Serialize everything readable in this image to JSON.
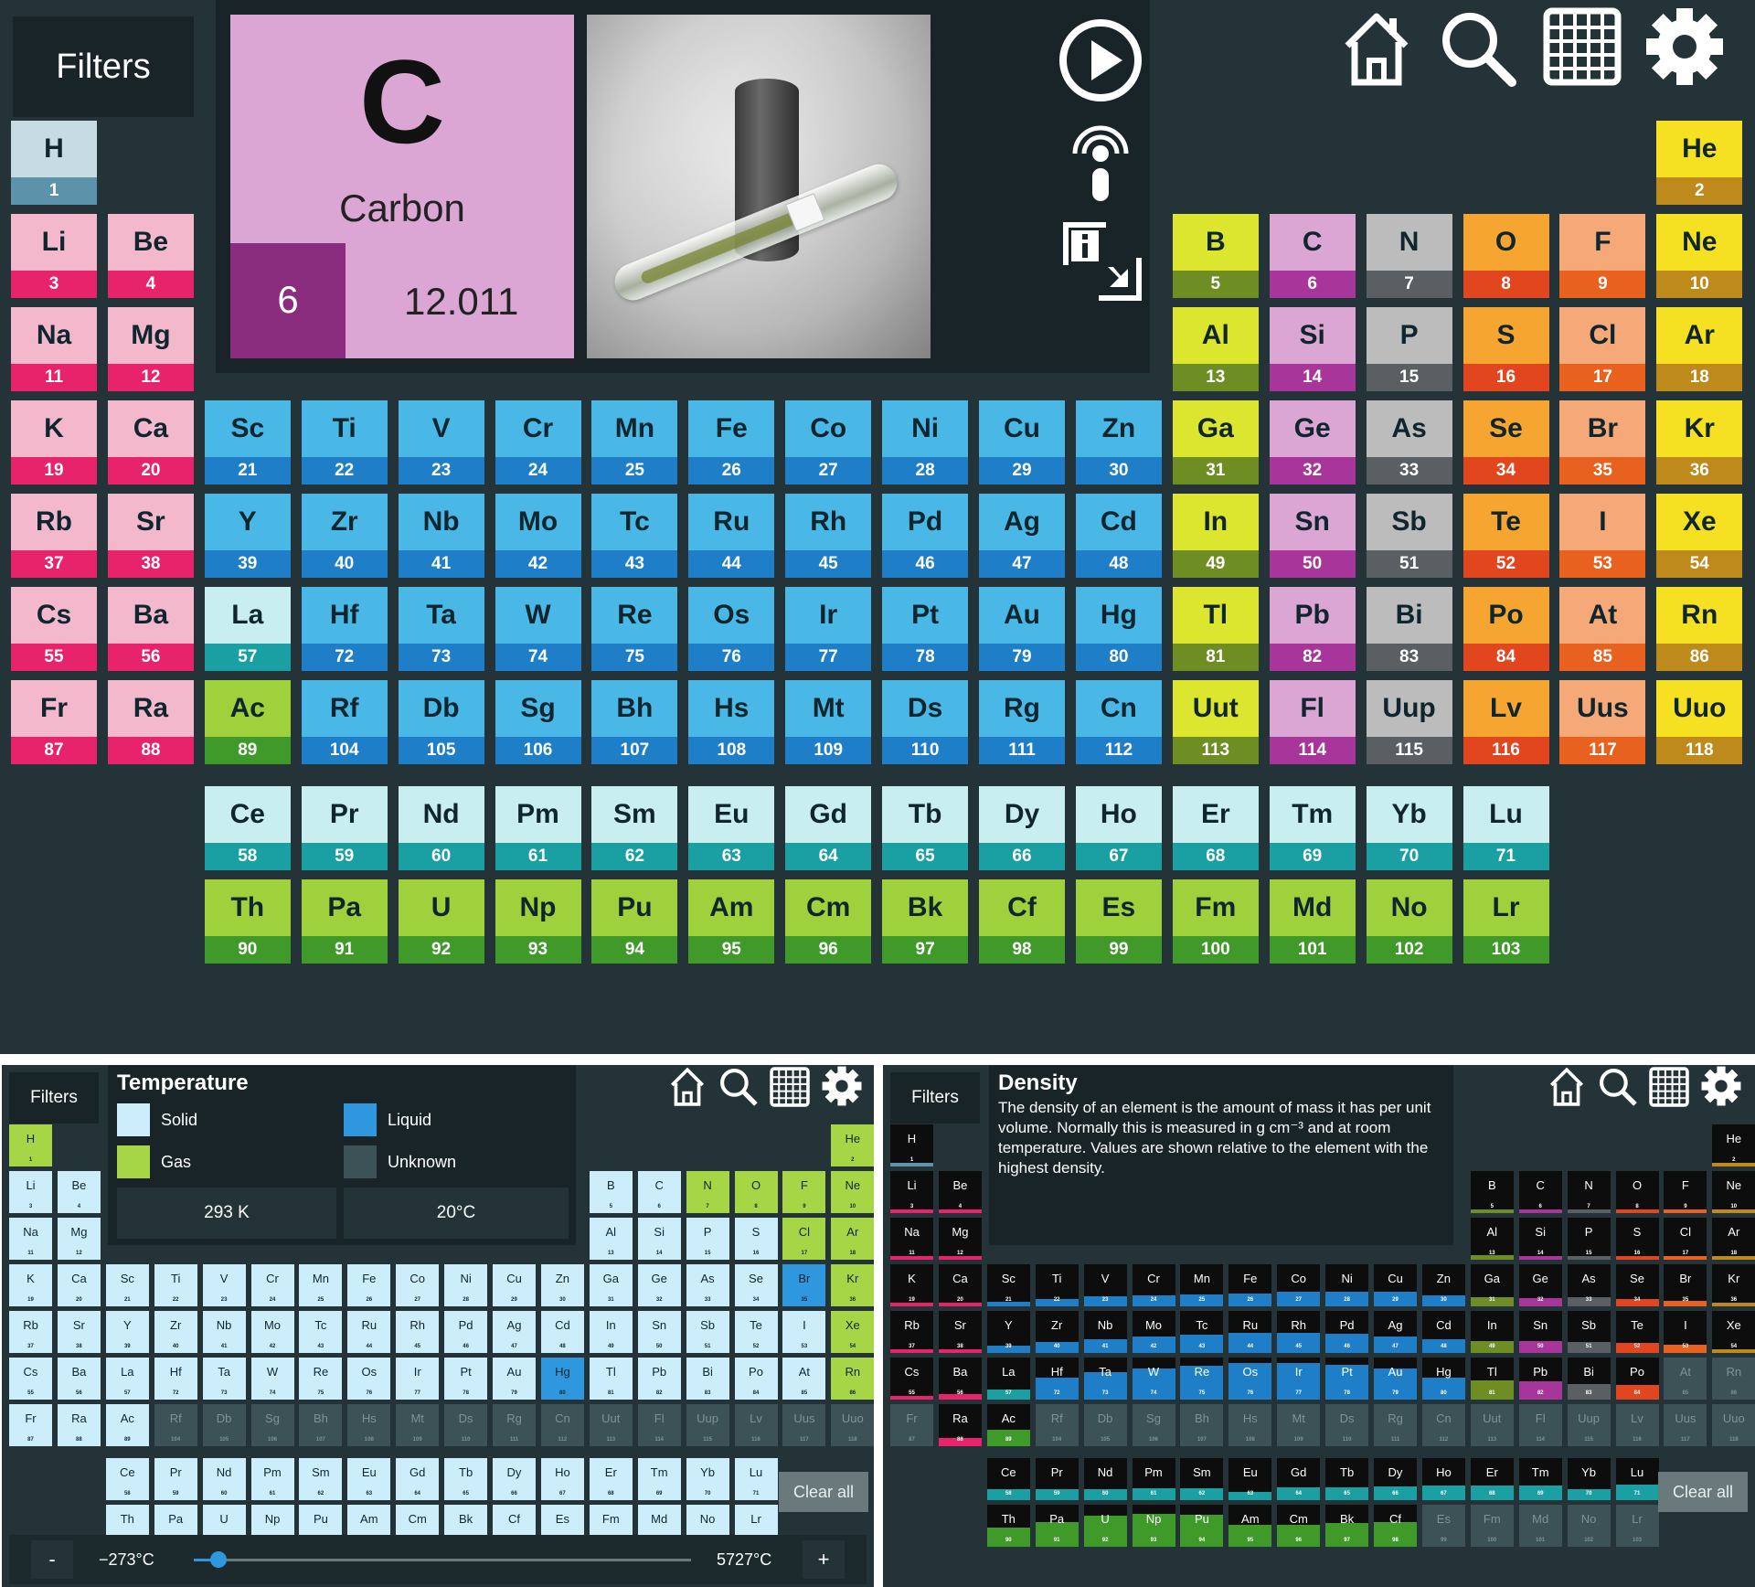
{
  "main": {
    "filters_label": "Filters",
    "selected": {
      "symbol": "C",
      "name": "Carbon",
      "number": "6",
      "mass": "12.011"
    },
    "side_icons": [
      "play-icon",
      "audio-icon",
      "info-icon"
    ],
    "toolbar_icons": [
      "home-icon",
      "search-icon",
      "grid-icon",
      "gear-icon"
    ]
  },
  "temperature_panel": {
    "filters_label": "Filters",
    "title": "Temperature",
    "legend": [
      {
        "label": "Solid",
        "color": "#cceefa"
      },
      {
        "label": "Liquid",
        "color": "#2f97dd"
      },
      {
        "label": "Gas",
        "color": "#a6d646"
      },
      {
        "label": "Unknown",
        "color": "#3c5256"
      }
    ],
    "kelvin": "293 K",
    "celsius": "20°C",
    "clear_label": "Clear all",
    "slider": {
      "minus": "-",
      "plus": "+",
      "min_label": "−273°C",
      "max_label": "5727°C",
      "value_fraction": 0.05
    }
  },
  "density_panel": {
    "filters_label": "Filters",
    "title": "Density",
    "description": "The density of an element is the amount of mass it has per unit volume. Normally this is measured in g cm⁻³ and at room temperature. Values are shown relative to the element with the highest density.",
    "clear_label": "Clear all"
  },
  "colors": {
    "background": "#243338",
    "panel": "#182428",
    "alkali": "#f4b8cd",
    "alkali_dark": "#e6236b",
    "transition": "#4ab8e6",
    "transition_dark": "#1e7fc8",
    "lanthanide": "#c9eef0",
    "lanthanide_dark": "#1aa0a3",
    "actinide": "#9ed13b",
    "actinide_dark": "#3f9a2a",
    "post_transition": "#dde62e",
    "post_transition_dark": "#6e8d22",
    "metalloid": "#dca6d4",
    "metalloid_dark": "#a8369a",
    "nonmetal": "#bcbcbc",
    "nonmetal_dark": "#5a5f63",
    "reactive": "#f6a630",
    "reactive_dark": "#e2461e",
    "halogen": "#f5a878",
    "halogen_dark": "#e8611e",
    "noble": "#f5e122",
    "noble_dark": "#bf8a1c"
  },
  "elements": [
    [
      "H",
      1,
      "hydrogen"
    ],
    [
      "He",
      2,
      "noble"
    ],
    [
      "Li",
      3,
      "alkali"
    ],
    [
      "Be",
      4,
      "alkali"
    ],
    [
      "B",
      5,
      "posttrans"
    ],
    [
      "C",
      6,
      "metalloid"
    ],
    [
      "N",
      7,
      "nonmetal"
    ],
    [
      "O",
      8,
      "reactive"
    ],
    [
      "F",
      9,
      "halogen"
    ],
    [
      "Ne",
      10,
      "noble"
    ],
    [
      "Na",
      11,
      "alkali"
    ],
    [
      "Mg",
      12,
      "alkali"
    ],
    [
      "Al",
      13,
      "posttrans"
    ],
    [
      "Si",
      14,
      "metalloid"
    ],
    [
      "P",
      15,
      "nonmetal"
    ],
    [
      "S",
      16,
      "reactive"
    ],
    [
      "Cl",
      17,
      "halogen"
    ],
    [
      "Ar",
      18,
      "noble"
    ],
    [
      "K",
      19,
      "alkali"
    ],
    [
      "Ca",
      20,
      "alkali"
    ],
    [
      "Sc",
      21,
      "transition"
    ],
    [
      "Ti",
      22,
      "transition"
    ],
    [
      "V",
      23,
      "transition"
    ],
    [
      "Cr",
      24,
      "transition"
    ],
    [
      "Mn",
      25,
      "transition"
    ],
    [
      "Fe",
      26,
      "transition"
    ],
    [
      "Co",
      27,
      "transition"
    ],
    [
      "Ni",
      28,
      "transition"
    ],
    [
      "Cu",
      29,
      "transition"
    ],
    [
      "Zn",
      30,
      "transition"
    ],
    [
      "Ga",
      31,
      "posttrans"
    ],
    [
      "Ge",
      32,
      "metalloid"
    ],
    [
      "As",
      33,
      "nonmetal"
    ],
    [
      "Se",
      34,
      "reactive"
    ],
    [
      "Br",
      35,
      "halogen"
    ],
    [
      "Kr",
      36,
      "noble"
    ],
    [
      "Rb",
      37,
      "alkali"
    ],
    [
      "Sr",
      38,
      "alkali"
    ],
    [
      "Y",
      39,
      "transition"
    ],
    [
      "Zr",
      40,
      "transition"
    ],
    [
      "Nb",
      41,
      "transition"
    ],
    [
      "Mo",
      42,
      "transition"
    ],
    [
      "Tc",
      43,
      "transition"
    ],
    [
      "Ru",
      44,
      "transition"
    ],
    [
      "Rh",
      45,
      "transition"
    ],
    [
      "Pd",
      46,
      "transition"
    ],
    [
      "Ag",
      47,
      "transition"
    ],
    [
      "Cd",
      48,
      "transition"
    ],
    [
      "In",
      49,
      "posttrans"
    ],
    [
      "Sn",
      50,
      "metalloid"
    ],
    [
      "Sb",
      51,
      "nonmetal"
    ],
    [
      "Te",
      52,
      "reactive"
    ],
    [
      "I",
      53,
      "halogen"
    ],
    [
      "Xe",
      54,
      "noble"
    ],
    [
      "Cs",
      55,
      "alkali"
    ],
    [
      "Ba",
      56,
      "alkali"
    ],
    [
      "La",
      57,
      "lanthanide"
    ],
    [
      "Hf",
      72,
      "transition"
    ],
    [
      "Ta",
      73,
      "transition"
    ],
    [
      "W",
      74,
      "transition"
    ],
    [
      "Re",
      75,
      "transition"
    ],
    [
      "Os",
      76,
      "transition"
    ],
    [
      "Ir",
      77,
      "transition"
    ],
    [
      "Pt",
      78,
      "transition"
    ],
    [
      "Au",
      79,
      "transition"
    ],
    [
      "Hg",
      80,
      "transition"
    ],
    [
      "Tl",
      81,
      "posttrans"
    ],
    [
      "Pb",
      82,
      "metalloid"
    ],
    [
      "Bi",
      83,
      "nonmetal"
    ],
    [
      "Po",
      84,
      "reactive"
    ],
    [
      "At",
      85,
      "halogen"
    ],
    [
      "Rn",
      86,
      "noble"
    ],
    [
      "Fr",
      87,
      "alkali"
    ],
    [
      "Ra",
      88,
      "alkali"
    ],
    [
      "Ac",
      89,
      "actinide"
    ],
    [
      "Rf",
      104,
      "transition"
    ],
    [
      "Db",
      105,
      "transition"
    ],
    [
      "Sg",
      106,
      "transition"
    ],
    [
      "Bh",
      107,
      "transition"
    ],
    [
      "Hs",
      108,
      "transition"
    ],
    [
      "Mt",
      109,
      "transition"
    ],
    [
      "Ds",
      110,
      "transition"
    ],
    [
      "Rg",
      111,
      "transition"
    ],
    [
      "Cn",
      112,
      "transition"
    ],
    [
      "Uut",
      113,
      "posttrans"
    ],
    [
      "Fl",
      114,
      "metalloid"
    ],
    [
      "Uup",
      115,
      "nonmetal"
    ],
    [
      "Lv",
      116,
      "reactive"
    ],
    [
      "Uus",
      117,
      "halogen"
    ],
    [
      "Uuo",
      118,
      "noble"
    ],
    [
      "Ce",
      58,
      "lanthanide"
    ],
    [
      "Pr",
      59,
      "lanthanide"
    ],
    [
      "Nd",
      60,
      "lanthanide"
    ],
    [
      "Pm",
      61,
      "lanthanide"
    ],
    [
      "Sm",
      62,
      "lanthanide"
    ],
    [
      "Eu",
      63,
      "lanthanide"
    ],
    [
      "Gd",
      64,
      "lanthanide"
    ],
    [
      "Tb",
      65,
      "lanthanide"
    ],
    [
      "Dy",
      66,
      "lanthanide"
    ],
    [
      "Ho",
      67,
      "lanthanide"
    ],
    [
      "Er",
      68,
      "lanthanide"
    ],
    [
      "Tm",
      69,
      "lanthanide"
    ],
    [
      "Yb",
      70,
      "lanthanide"
    ],
    [
      "Lu",
      71,
      "lanthanide"
    ],
    [
      "Th",
      90,
      "actinide"
    ],
    [
      "Pa",
      91,
      "actinide"
    ],
    [
      "U",
      92,
      "actinide"
    ],
    [
      "Np",
      93,
      "actinide"
    ],
    [
      "Pu",
      94,
      "actinide"
    ],
    [
      "Am",
      95,
      "actinide"
    ],
    [
      "Cm",
      96,
      "actinide"
    ],
    [
      "Bk",
      97,
      "actinide"
    ],
    [
      "Cf",
      98,
      "actinide"
    ],
    [
      "Es",
      99,
      "actinide"
    ],
    [
      "Fm",
      100,
      "actinide"
    ],
    [
      "Md",
      101,
      "actinide"
    ],
    [
      "No",
      102,
      "actinide"
    ],
    [
      "Lr",
      103,
      "actinide"
    ]
  ]
}
